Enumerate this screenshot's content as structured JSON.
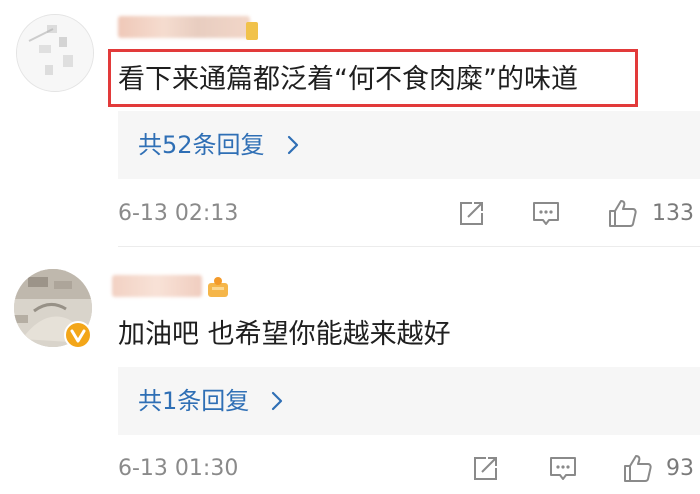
{
  "comments": [
    {
      "text": "看下来通篇都泛着“何不食肉糜”的味道",
      "replies_label": "共52条回复",
      "timestamp": "6-13 02:13",
      "likes": "133",
      "highlighted": true
    },
    {
      "text": "加油吧 也希望你能越来越好",
      "replies_label": "共1条回复",
      "timestamp": "6-13 01:30",
      "likes": "93",
      "verified": true
    }
  ],
  "icons": {
    "share": "share-icon",
    "reply": "reply-comment-icon",
    "like": "thumbs-up-icon",
    "chevron": "chevron-right-icon",
    "verified": "verified-v-badge-icon",
    "member": "member-badge-icon"
  },
  "colors": {
    "link": "#2f6fb5",
    "highlight_border": "#e23a3a",
    "reply_bg": "#f6f6f6",
    "verified_badge": "#f3a619"
  }
}
